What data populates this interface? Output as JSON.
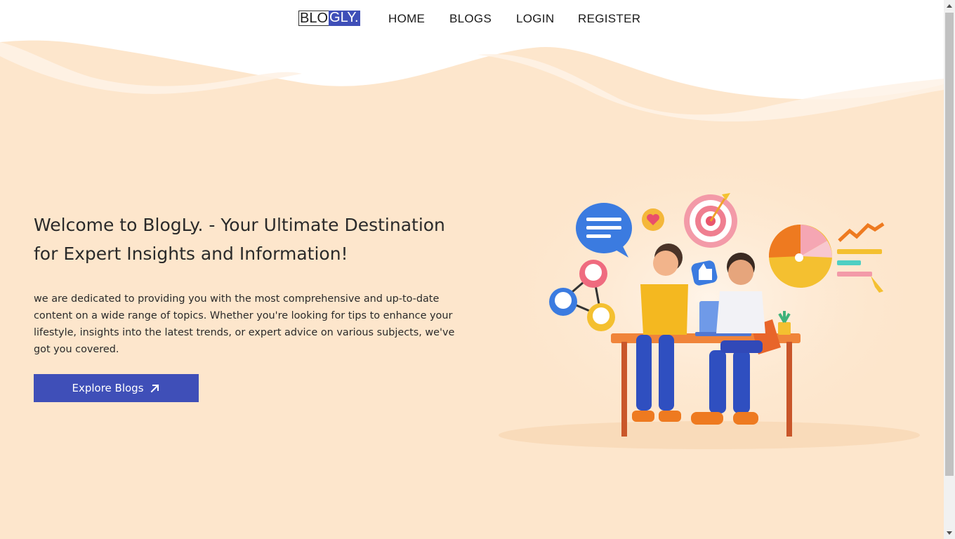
{
  "brand": {
    "logo_part1": "BLO",
    "logo_part2": "GLY."
  },
  "nav": {
    "home": "HOME",
    "blogs": "BLOGS",
    "login": "LOGIN",
    "register": "REGISTER"
  },
  "hero": {
    "title": "Welcome to BlogLy. - Your Ultimate Destination for Expert Insights and Information!",
    "description": "we are dedicated to providing you with the most comprehensive and up-to-date content on a wide range of topics. Whether you're looking for tips to enhance your lifestyle, insights into the latest trends, or expert advice on various subjects, we've got you covered.",
    "cta_label": "Explore Blogs",
    "cta_icon": "arrow-up-right-icon"
  },
  "colors": {
    "background": "#fde6cc",
    "accent": "#3f4fb8",
    "text": "#2a2a2a"
  }
}
